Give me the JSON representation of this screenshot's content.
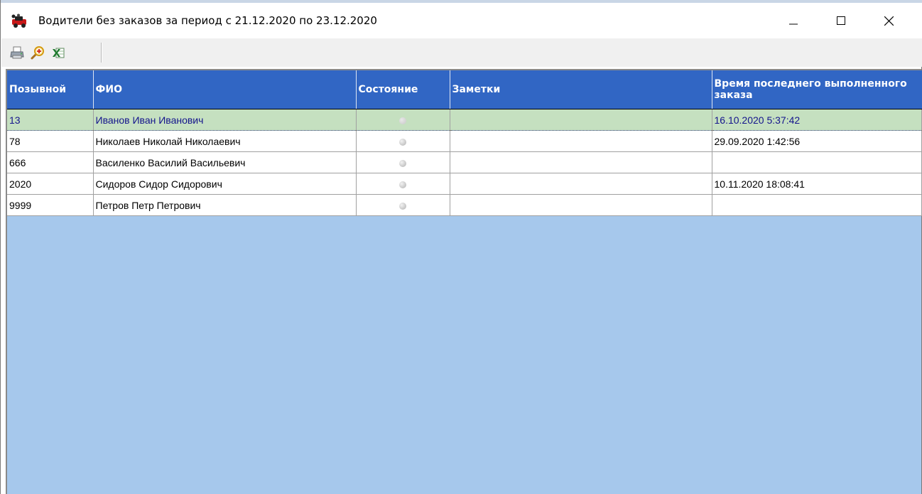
{
  "window": {
    "title": "Водители без заказов за период с 21.12.2020 по 23.12.2020"
  },
  "toolbar": {
    "buttons": [
      {
        "icon": "printer-icon"
      },
      {
        "icon": "zoom-icon"
      },
      {
        "icon": "excel-icon"
      }
    ]
  },
  "table": {
    "columns": {
      "callsign": "Позывной",
      "fio": "ФИО",
      "status": "Состояние",
      "notes": "Заметки",
      "last_order": "Время последнего выполненного заказа"
    },
    "rows": [
      {
        "callsign": "13",
        "fio": "Иванов Иван Иванович",
        "notes": "",
        "last_order": "16.10.2020 5:37:42"
      },
      {
        "callsign": "78",
        "fio": "Николаев Николай Николаевич",
        "notes": "",
        "last_order": "29.09.2020 1:42:56"
      },
      {
        "callsign": "666",
        "fio": "Василенко Василий Васильевич",
        "notes": "",
        "last_order": ""
      },
      {
        "callsign": "2020",
        "fio": "Сидоров Сидор Сидорович",
        "notes": "",
        "last_order": "10.11.2020 18:08:41"
      },
      {
        "callsign": "9999",
        "fio": "Петров Петр Петрович",
        "notes": "",
        "last_order": ""
      }
    ],
    "selected_row": 0
  },
  "colors": {
    "header_bg": "#3166c4",
    "grid_bg": "#a6c8ec",
    "selected_row_bg": "#c5e0c0",
    "selected_row_text": "#14148c"
  }
}
